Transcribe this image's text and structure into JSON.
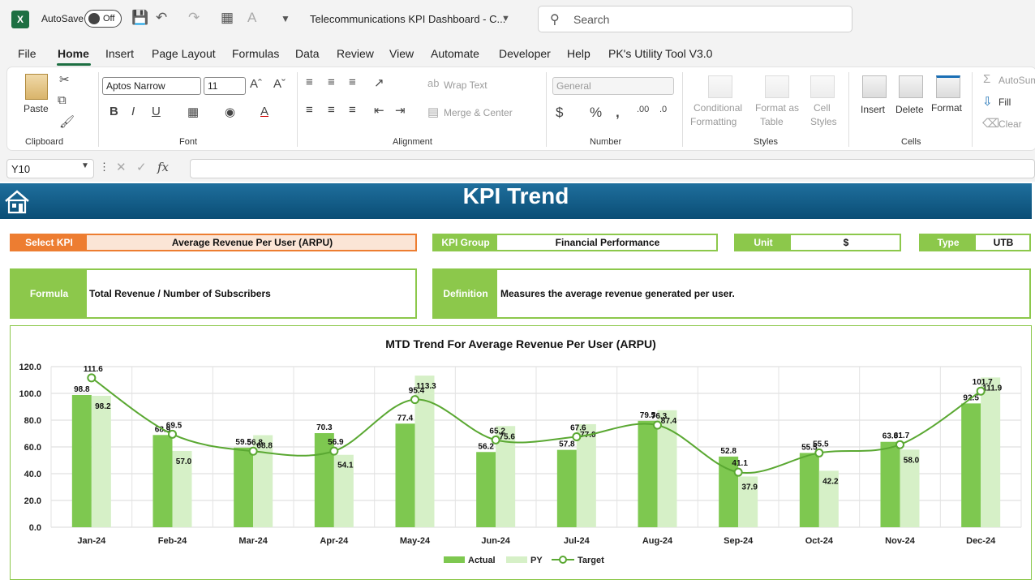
{
  "titlebar": {
    "autosave_label": "AutoSave",
    "autosave_state": "Off",
    "doc_title": "Telecommunications KPI Dashboard - C...",
    "search_placeholder": "Search"
  },
  "menu": [
    "File",
    "Home",
    "Insert",
    "Page Layout",
    "Formulas",
    "Data",
    "Review",
    "View",
    "Automate",
    "Developer",
    "Help",
    "PK's Utility Tool V3.0"
  ],
  "menu_active": "Home",
  "ribbon": {
    "clipboard": {
      "paste": "Paste",
      "label": "Clipboard"
    },
    "font": {
      "name": "Aptos Narrow",
      "size": "11",
      "label": "Font",
      "bold": "B",
      "italic": "I",
      "underline": "U"
    },
    "alignment": {
      "wrap_text": "Wrap Text",
      "merge_center": "Merge & Center",
      "label": "Alignment"
    },
    "number": {
      "format": "General",
      "label": "Number"
    },
    "styles": {
      "conditional": "Conditional",
      "formatting": "Formatting",
      "format_as": "Format as",
      "table": "Table",
      "cell": "Cell",
      "cell_styles": "Styles",
      "label": "Styles"
    },
    "cells": {
      "insert": "Insert",
      "delete": "Delete",
      "format": "Format",
      "label": "Cells"
    },
    "editing": {
      "autosum": "AutoSum",
      "fill": "Fill",
      "clear": "Clear"
    }
  },
  "formula_bar": {
    "name_box": "Y10",
    "fx": "fx",
    "content": ""
  },
  "dashboard": {
    "title": "KPI Trend",
    "select_kpi_label": "Select KPI",
    "select_kpi_value": "Average Revenue Per User (ARPU)",
    "kpi_group_label": "KPI Group",
    "kpi_group_value": "Financial Performance",
    "unit_label": "Unit",
    "unit_value": "$",
    "type_label": "Type",
    "type_value": "UTB",
    "formula_label": "Formula",
    "formula_value": "Total Revenue / Number of Subscribers",
    "definition_label": "Definition",
    "definition_value": "Measures the average revenue generated per user."
  },
  "colors": {
    "actual": "#7ec850",
    "py": "#d6f0c7",
    "target": "#5aa832",
    "banner": "#1a5f8a",
    "accent_orange": "#ed7d31"
  },
  "chart_data": {
    "type": "bar",
    "title": "MTD Trend For Average Revenue Per User (ARPU)",
    "categories": [
      "Jan-24",
      "Feb-24",
      "Mar-24",
      "Apr-24",
      "May-24",
      "Jun-24",
      "Jul-24",
      "Aug-24",
      "Sep-24",
      "Oct-24",
      "Nov-24",
      "Dec-24"
    ],
    "series": [
      {
        "name": "Actual",
        "type": "bar",
        "values": [
          98.8,
          68.9,
          59.5,
          70.3,
          77.4,
          56.2,
          57.8,
          79.5,
          52.8,
          55.5,
          63.8,
          92.5
        ]
      },
      {
        "name": "PY",
        "type": "bar",
        "values": [
          98.2,
          57.0,
          68.8,
          54.1,
          113.3,
          75.6,
          77.0,
          87.4,
          37.9,
          42.2,
          58.0,
          111.9
        ]
      },
      {
        "name": "Target",
        "type": "line",
        "values": [
          111.6,
          69.5,
          56.8,
          56.9,
          95.4,
          65.2,
          67.6,
          76.3,
          41.1,
          55.5,
          61.7,
          101.7
        ]
      }
    ],
    "ylim": [
      0,
      120
    ],
    "yticks": [
      "0.0",
      "20.0",
      "40.0",
      "60.0",
      "80.0",
      "100.0",
      "120.0"
    ],
    "grid": true,
    "legend": "bottom"
  }
}
